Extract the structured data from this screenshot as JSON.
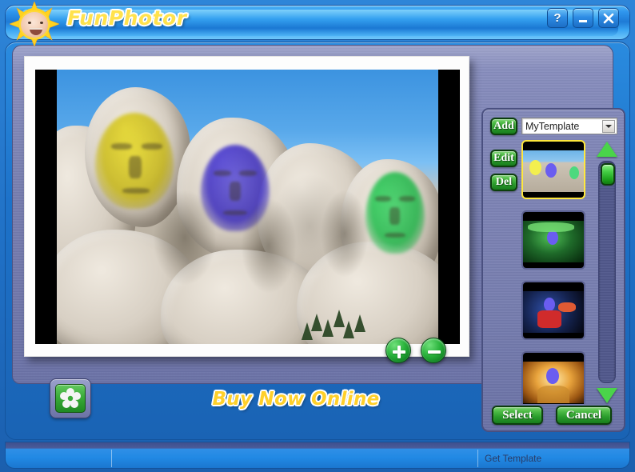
{
  "window": {
    "title": "FunPhotor",
    "logo_icon": "sun-baby-logo",
    "buttons": [
      {
        "name": "help-button",
        "icon": "question-mark-icon",
        "label": "?"
      },
      {
        "name": "minimize-button",
        "icon": "minimize-icon",
        "label": ""
      },
      {
        "name": "close-button",
        "icon": "close-x-icon",
        "label": ""
      }
    ]
  },
  "editor": {
    "photo_alt": "Mount Rushmore with colored face overlays",
    "zoom_in_label": "+",
    "zoom_out_label": "−",
    "settings_icon": "gear-flower-icon",
    "buy_now_label": "Buy Now Online"
  },
  "template_panel": {
    "add_label": "Add",
    "edit_label": "Edit",
    "del_label": "Del",
    "select_label": "Select",
    "cancel_label": "Cancel",
    "combo": {
      "value": "MyTemplate",
      "placeholder": "MyTemplate",
      "arrow_icon": "chevron-down-icon",
      "options": [
        "MyTemplate"
      ]
    },
    "scroll": {
      "up_icon": "triangle-up-icon",
      "down_icon": "triangle-down-icon",
      "thumb_name": "scrollbar-thumb"
    },
    "thumbnails": [
      {
        "name": "template-thumb-rushmore",
        "selected": true
      },
      {
        "name": "template-thumb-green-hero",
        "selected": false
      },
      {
        "name": "template-thumb-superhero",
        "selected": false
      },
      {
        "name": "template-thumb-portrait",
        "selected": false
      }
    ]
  },
  "statusbar": {
    "pane1": "",
    "pane2": "",
    "pane3": "Get Template"
  },
  "colors": {
    "accent_blue": "#2189e4",
    "panel_purple": "#767daf",
    "button_green": "#2a9c2c",
    "title_yellow": "#ffe24d",
    "selection_yellow": "#ffe83d"
  }
}
